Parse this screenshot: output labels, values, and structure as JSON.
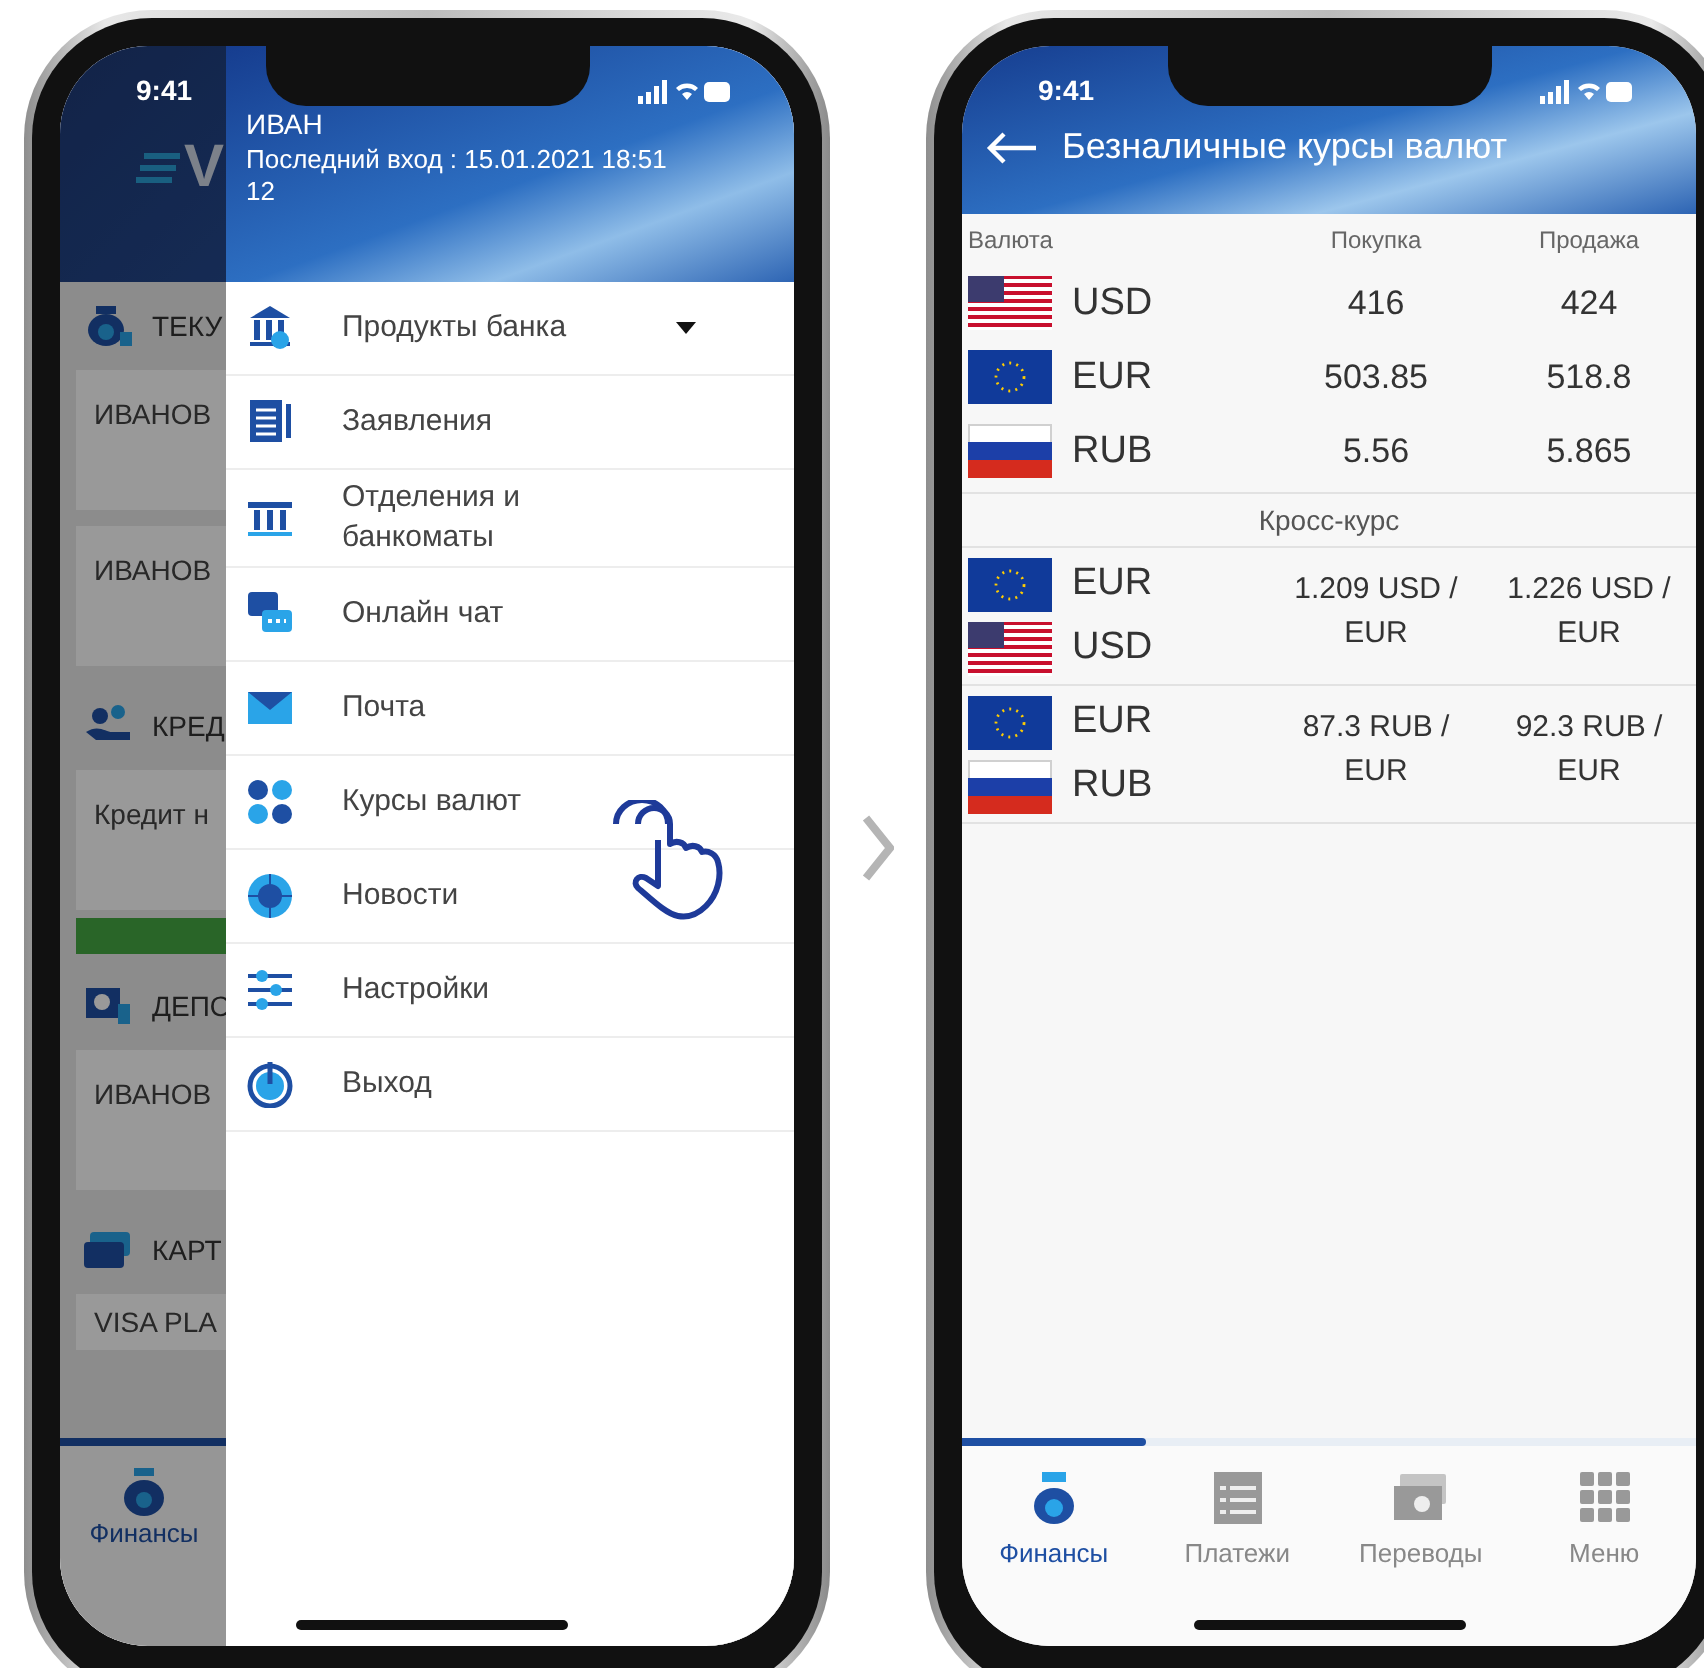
{
  "left_screen": {
    "status_bar": {
      "time": "9:41"
    },
    "background_app": {
      "logo_text": "V",
      "sections": [
        {
          "kind": "bag",
          "title": "ТЕКУ",
          "cards": [
            {
              "text": "ИВАНОВ",
              "kind": "card"
            },
            {
              "text": "ИВАНОВ",
              "kind": "card"
            }
          ]
        },
        {
          "kind": "credit",
          "title": "КРЕД",
          "cards": [
            {
              "text": "Кредит н",
              "kind": "card_action"
            }
          ]
        },
        {
          "kind": "deposit",
          "title": "ДЕПО",
          "cards": [
            {
              "text": "ИВАНОВ",
              "kind": "card"
            }
          ]
        },
        {
          "kind": "cards",
          "title": "КАРТ",
          "cards": [
            {
              "text": "VISA PLA",
              "kind": "short"
            }
          ]
        }
      ],
      "tab_bar": [
        {
          "label": "Финансы",
          "selected": true
        }
      ]
    },
    "drawer": {
      "user_name": "ИВАН",
      "last_login": "Последний вход : 15.01.2021 18:51 12",
      "items": [
        {
          "kind": "bank",
          "label": "Продукты банка",
          "expandable": true
        },
        {
          "kind": "forms",
          "label": "Заявления",
          "expandable": false
        },
        {
          "kind": "branches",
          "label": "Отделения и банкоматы",
          "expandable": false
        },
        {
          "kind": "chat",
          "label": "Онлайн чат",
          "expandable": false
        },
        {
          "kind": "mail",
          "label": "Почта",
          "expandable": false
        },
        {
          "kind": "rates",
          "label": "Курсы валют",
          "expandable": false
        },
        {
          "kind": "news",
          "label": "Новости",
          "expandable": false
        },
        {
          "kind": "settings",
          "label": "Настройки",
          "expandable": false
        },
        {
          "kind": "exit",
          "label": "Выход",
          "expandable": false
        }
      ]
    }
  },
  "right_screen": {
    "status_bar": {
      "time": "9:41"
    },
    "title": "Безналичные курсы валют",
    "table": {
      "columns": [
        "Валюта",
        "Покупка",
        "Продажа"
      ],
      "rows": [
        {
          "currencies": [
            {
              "code": "USD",
              "kind": "us"
            }
          ],
          "buy": "416",
          "sell": "424"
        },
        {
          "currencies": [
            {
              "code": "EUR",
              "kind": "eu"
            }
          ],
          "buy": "503.85",
          "sell": "518.8"
        },
        {
          "currencies": [
            {
              "code": "RUB",
              "kind": "ru"
            }
          ],
          "buy": "5.56",
          "sell": "5.865"
        }
      ],
      "cross_title": "Кросс-курс",
      "cross_rows": [
        {
          "currencies": [
            {
              "code": "EUR",
              "kind": "eu"
            },
            {
              "code": "USD",
              "kind": "us"
            }
          ],
          "buy": "1.209 USD / EUR",
          "sell": "1.226 USD / EUR"
        },
        {
          "currencies": [
            {
              "code": "EUR",
              "kind": "eu"
            },
            {
              "code": "RUB",
              "kind": "ru"
            }
          ],
          "buy": "87.3 RUB / EUR",
          "sell": "92.3 RUB / EUR"
        }
      ]
    },
    "tab_bar": [
      {
        "kind": "finance",
        "label": "Финансы",
        "selected": true
      },
      {
        "kind": "payments",
        "label": "Платежи",
        "selected": false
      },
      {
        "kind": "transfers",
        "label": "Переводы",
        "selected": false
      },
      {
        "kind": "menu",
        "label": "Меню",
        "selected": false
      }
    ]
  }
}
